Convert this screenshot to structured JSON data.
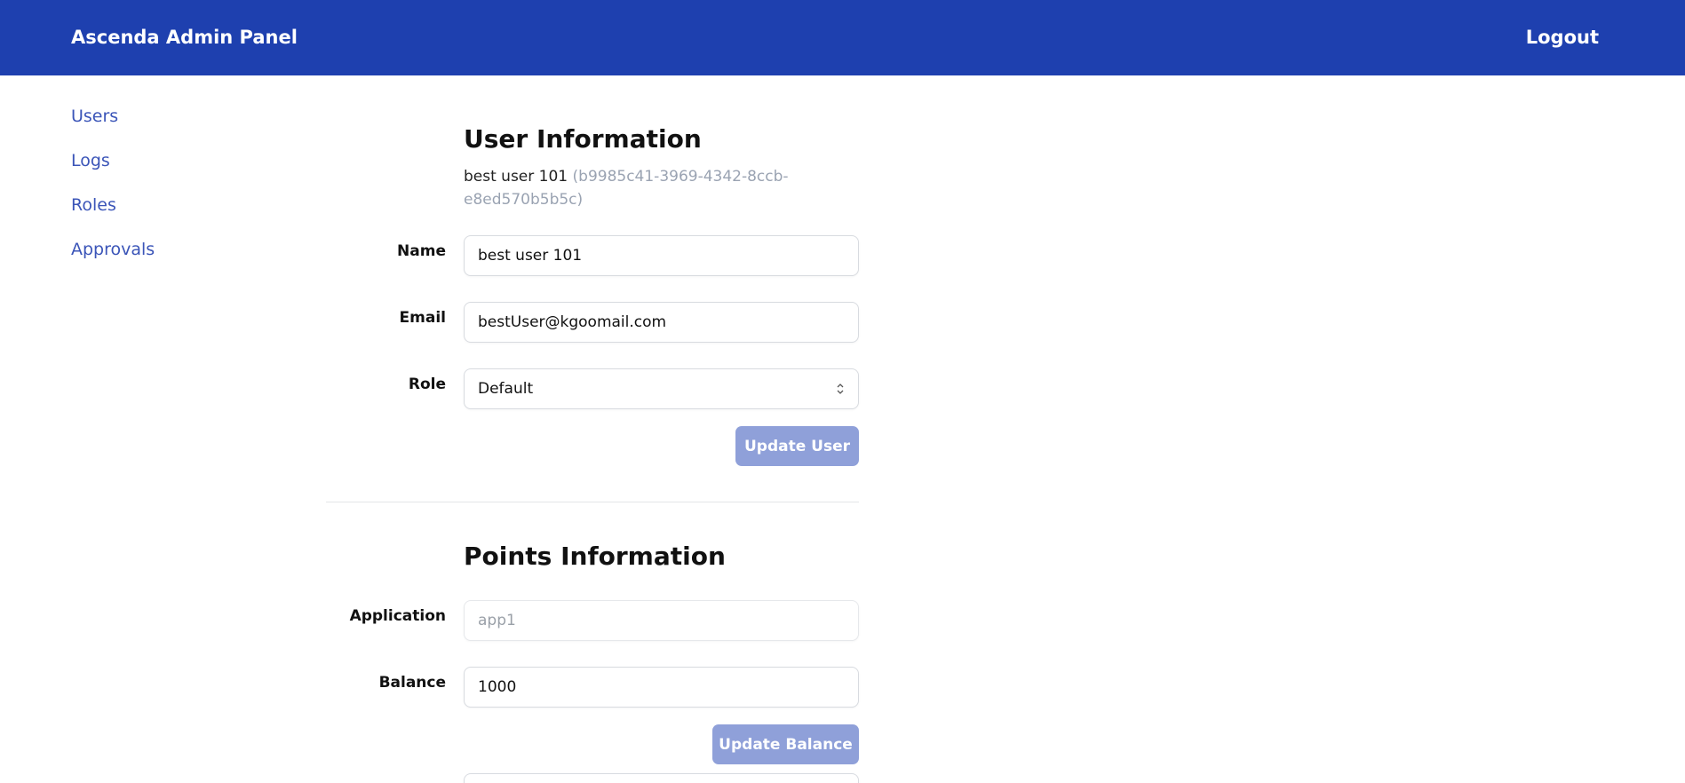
{
  "header": {
    "title": "Ascenda Admin Panel",
    "logout_label": "Logout",
    "color": "#1e40af"
  },
  "sidebar": {
    "items": [
      {
        "label": "Users"
      },
      {
        "label": "Logs"
      },
      {
        "label": "Roles"
      },
      {
        "label": "Approvals"
      }
    ]
  },
  "user_info": {
    "title": "User Information",
    "display_name": "best user 101",
    "user_id": "(b9985c41-3969-4342-8ccb-e8ed570b5b5c)",
    "fields": {
      "name_label": "Name",
      "name_value": "best user 101",
      "email_label": "Email",
      "email_value": "bestUser@kgoomail.com",
      "role_label": "Role",
      "role_value": "Default"
    },
    "update_label": "Update User"
  },
  "points_info": {
    "title": "Points Information",
    "fields": {
      "application_label": "Application",
      "application_value": "app1",
      "balance_label": "Balance",
      "balance_value": "1000"
    },
    "update_label": "Update Balance"
  },
  "colors": {
    "button_disabled": "#8fa0d9",
    "link": "#3b55b8"
  }
}
